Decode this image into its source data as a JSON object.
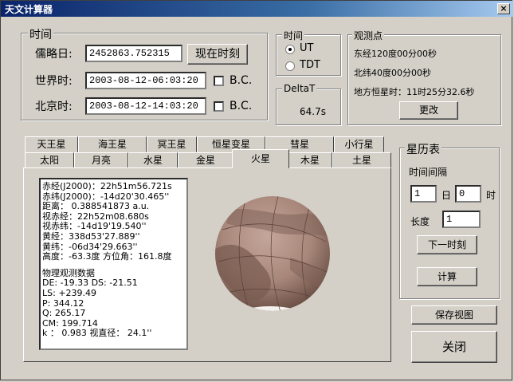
{
  "window": {
    "title": "天文计算器",
    "close_glyph": "×"
  },
  "time_group": {
    "label": "时间",
    "julian_label": "儒略日:",
    "julian_value": "2452863.752315",
    "now_button": "现在时刻",
    "ut_label": "世界时:",
    "ut_value": "2003-08-12-06:03:20",
    "bj_label": "北京时:",
    "bj_value": "2003-08-12-14:03:20",
    "bc_label": "B.C."
  },
  "timescale_group": {
    "label": "时间",
    "ut": "UT",
    "tdt": "TDT",
    "selected": "UT"
  },
  "deltat_group": {
    "label": "DeltaT",
    "value": "64.7s"
  },
  "observer_group": {
    "label": "观测点",
    "longitude": "东经120度00分00秒",
    "latitude": "北纬40度00分00秒",
    "sidereal": "地方恒星时：11时25分32.6秒",
    "change_button": "更改"
  },
  "tabs_row1": [
    "天王星",
    "海王星",
    "冥王星",
    "恒星变星",
    "彗星",
    "小行星"
  ],
  "tabs_row2": [
    "太阳",
    "月亮",
    "水星",
    "金星",
    "火星",
    "木星",
    "土星"
  ],
  "active_tab": "火星",
  "info_lines": [
    "赤经(J2000)：22h51m56.721s",
    "赤纬(J2000)：-14d20'30.465''",
    "距离：  0.388541873 a.u.",
    "视赤经：22h52m08.680s",
    "视赤纬：-14d19'19.540''",
    "黄经：338d53'27.889''",
    "黄纬：-06d34'29.663''",
    "高度：-63.3度 方位角：161.8度",
    "",
    "物理观测数据",
    "DE: -19.33   DS: -21.51",
    "LS: +239.49",
    "P:  344.12",
    "Q:  265.17",
    "CM: 199.714",
    "k ：  0.983   视直径：  24.1''"
  ],
  "ephemeris_group": {
    "label": "星历表",
    "interval_label": "时间间隔",
    "days_value": "1",
    "days_unit": "日",
    "hours_value": "0",
    "hours_unit": "时",
    "length_label": "长度",
    "length_value": "1",
    "next_button": "下一时刻",
    "compute_button": "计算"
  },
  "save_view_button": "保存视图",
  "close_button": "关闭",
  "colors": {
    "titlebar_start": "#0a246a",
    "window_bg": "#d4d0c8",
    "planet": "#a8877a"
  }
}
